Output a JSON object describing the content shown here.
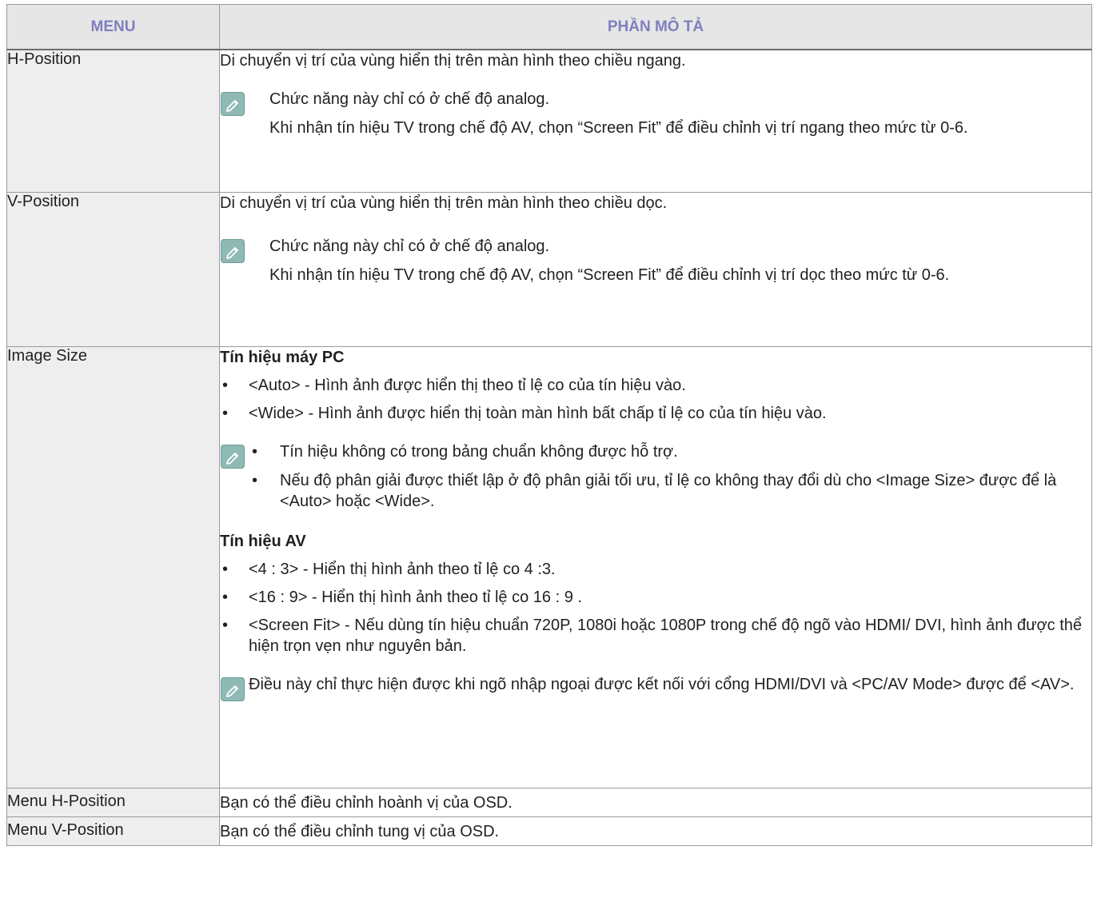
{
  "table": {
    "header": {
      "menu": "MENU",
      "description": "PHẦN MÔ TẢ"
    },
    "rows": {
      "h_position": {
        "menu": "H-Position",
        "desc": "Di chuyển vị trí của vùng hiển thị trên màn hình theo chiều ngang.",
        "note": [
          "Chức năng này chỉ có ở chế độ analog.",
          "Khi nhận tín hiệu TV trong chế độ AV, chọn “Screen Fit” để điều chỉnh vị trí ngang theo mức từ 0-6."
        ]
      },
      "v_position": {
        "menu": "V-Position",
        "desc": "Di chuyển vị trí của vùng hiển thị trên màn hình theo chiều dọc.",
        "note": [
          "Chức năng này chỉ có ở chế độ analog.",
          "Khi nhận tín hiệu TV trong chế độ AV, chọn “Screen Fit” để điều chỉnh vị trí dọc theo mức từ 0-6."
        ]
      },
      "image_size": {
        "menu": "Image Size",
        "pc_heading": "Tín hiệu máy PC",
        "pc_items": [
          "<Auto> - Hình ảnh được hiển thị theo tỉ lệ co của tín hiệu vào.",
          "<Wide> - Hình ảnh được hiển thị toàn màn hình bất chấp tỉ lệ co của tín hiệu vào."
        ],
        "pc_note_items": [
          "Tín hiệu không có trong bảng chuẩn không được hỗ trợ.",
          "Nếu độ phân giải được thiết lập ở độ phân giải tối ưu, tỉ lệ co không thay đổi dù cho <Image Size> được để là <Auto> hoặc <Wide>."
        ],
        "av_heading": "Tín hiệu AV",
        "av_items": [
          "<4 : 3> - Hiển thị hình ảnh theo tỉ lệ co 4 :3.",
          "<16 : 9> - Hiển thị hình ảnh theo tỉ lệ co 16 : 9 .",
          "<Screen Fit> - Nếu dùng tín hiệu chuẩn 720P, 1080i hoặc 1080P trong chế độ ngõ vào HDMI/ DVI, hình ảnh được thể hiện trọn vẹn như nguyên bản."
        ],
        "av_note": "Điều này chỉ thực hiện được khi ngõ nhập ngoại được kết nối với cổng HDMI/DVI và <PC/AV Mode> được để <AV>."
      },
      "menu_h_position": {
        "menu": "Menu H-Position",
        "desc": "Bạn có thể điều chỉnh hoành vị của OSD."
      },
      "menu_v_position": {
        "menu": "Menu V-Position",
        "desc": "Bạn có thể điều chỉnh tung vị của OSD."
      }
    }
  },
  "bullet_symbol": "•",
  "icon": "note-pencil-icon",
  "colors": {
    "header_text": "#7f7fbf",
    "header_bg": "#e6e6e6",
    "menu_bg": "#eeeeee",
    "note_icon": "#8fb9b5"
  }
}
